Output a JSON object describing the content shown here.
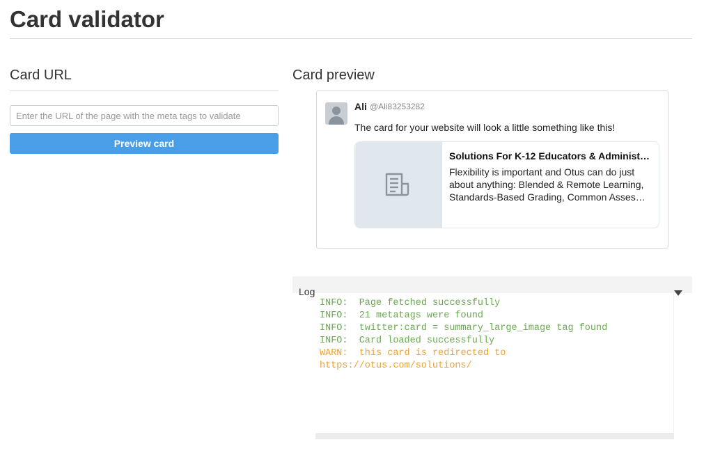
{
  "page": {
    "title": "Card validator"
  },
  "card_url": {
    "heading": "Card URL",
    "input_placeholder": "Enter the URL of the page with the meta tags to validate",
    "input_value": "",
    "button_label": "Preview card"
  },
  "card_preview": {
    "heading": "Card preview",
    "user": {
      "name": "Ali",
      "handle": "@Ali83253282"
    },
    "tweet_text": "The card for your website will look a little something like this!",
    "card": {
      "title": "Solutions For K-12 Educators & Administ…",
      "description_lines": [
        "Flexibility is important and Otus can do just",
        "about anything: Blended & Remote Learning,",
        "Standards-Based Grading, Common Asses…"
      ],
      "thumbnail_icon": "document-icon"
    }
  },
  "log": {
    "label": "Log",
    "toggle_icon": "triangle-down-icon",
    "lines": [
      {
        "level": "info",
        "text": "INFO:  Page fetched successfully"
      },
      {
        "level": "info",
        "text": "INFO:  21 metatags were found"
      },
      {
        "level": "info",
        "text": "INFO:  twitter:card = summary_large_image tag found"
      },
      {
        "level": "info",
        "text": "INFO:  Card loaded successfully"
      },
      {
        "level": "warn",
        "text": "WARN:  this card is redirected to"
      },
      {
        "level": "warn",
        "text": "https://otus.com/solutions/"
      }
    ]
  },
  "colors": {
    "button": "#4a9ee8",
    "info": "#6aaa50",
    "warn": "#f0a030"
  }
}
